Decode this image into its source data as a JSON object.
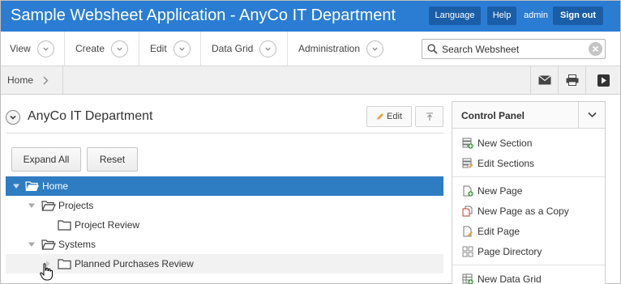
{
  "header": {
    "title": "Sample Websheet Application - AnyCo IT Department",
    "language_label": "Language",
    "help_label": "Help",
    "user": "admin",
    "signout_label": "Sign out",
    "color": "#2a7dd3"
  },
  "menu": {
    "items": [
      {
        "label": "View",
        "icon": "chevron-down-icon"
      },
      {
        "label": "Create",
        "icon": "chevron-down-icon"
      },
      {
        "label": "Edit",
        "icon": "chevron-down-icon"
      },
      {
        "label": "Data Grid",
        "icon": "chevron-down-icon"
      },
      {
        "label": "Administration",
        "icon": "chevron-down-icon"
      }
    ],
    "search": {
      "value": "Search Websheet",
      "icon": "search-icon"
    }
  },
  "breadcrumb": {
    "items": [
      "Home"
    ],
    "tools": [
      "mail-icon",
      "print-icon",
      "play-icon"
    ]
  },
  "region": {
    "title": "AnyCo IT Department",
    "edit_label": "Edit",
    "expand_all_label": "Expand All",
    "reset_label": "Reset"
  },
  "tree": {
    "nodes": [
      {
        "label": "Home",
        "level": 0,
        "expanded": true,
        "selected": true
      },
      {
        "label": "Projects",
        "level": 1,
        "expanded": true
      },
      {
        "label": "Project Review",
        "level": 2
      },
      {
        "label": "Systems",
        "level": 1,
        "expanded": true
      },
      {
        "label": "Planned Purchases Review",
        "level": 2
      }
    ],
    "selected_color": "#2e7cc2"
  },
  "control_panel": {
    "title": "Control Panel",
    "items": [
      {
        "label": "New Section",
        "icon": "new-section-icon"
      },
      {
        "label": "Edit Sections",
        "icon": "edit-sections-icon"
      },
      {
        "label": "New Page",
        "icon": "new-page-icon"
      },
      {
        "label": "New Page as a Copy",
        "icon": "copy-page-icon"
      },
      {
        "label": "Edit Page",
        "icon": "edit-page-icon"
      },
      {
        "label": "Page Directory",
        "icon": "page-directory-icon"
      },
      {
        "label": "New Data Grid",
        "icon": "new-data-grid-icon"
      }
    ]
  }
}
